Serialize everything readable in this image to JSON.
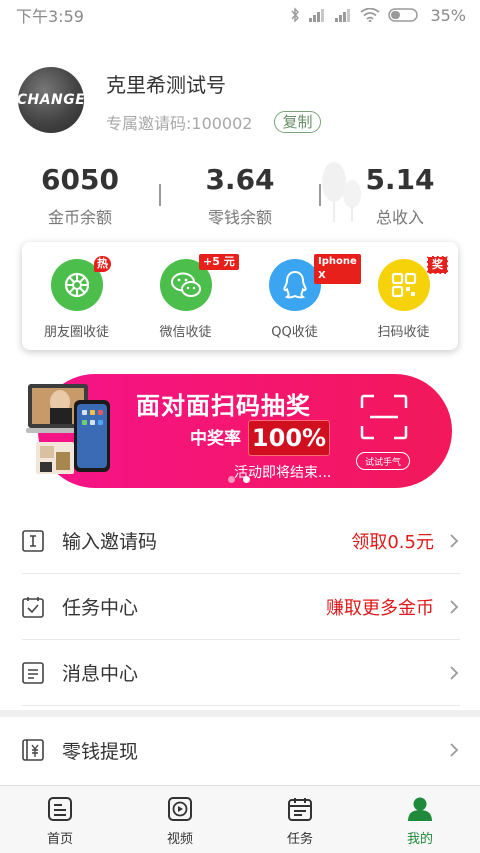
{
  "status_bar": {
    "time": "下午3:59",
    "battery": "35%"
  },
  "profile": {
    "avatar_text": "CHANGE",
    "name": "克里希测试号",
    "invite_code": "专属邀请码:100002",
    "copy_label": "复制"
  },
  "stats": [
    {
      "value": "6050",
      "label": "金币余额"
    },
    {
      "value": "3.64",
      "label": "零钱余额"
    },
    {
      "value": "5.14",
      "label": "总收入"
    }
  ],
  "share": {
    "items": [
      {
        "label": "朋友圈收徒",
        "badge": "热",
        "icon": "moments-icon",
        "color": "#4cbe4c"
      },
      {
        "label": "微信收徒",
        "badge": "+5 元",
        "icon": "wechat-icon",
        "color": "#4cbe4c"
      },
      {
        "label": "QQ收徒",
        "badge": "Iphone X",
        "icon": "qq-icon",
        "color": "#3ba5f2"
      },
      {
        "label": "扫码收徒",
        "badge": "奖",
        "icon": "qrcode-icon",
        "color": "#f5d20a"
      }
    ]
  },
  "banner": {
    "title": "面对面扫码抽奖",
    "rate_label": "中奖率",
    "rate_value": "100%",
    "ending_text": "活动即将结束...",
    "try_label": "试试手气",
    "accent": "#f5138a"
  },
  "list": [
    {
      "label": "输入邀请码",
      "right": "领取0.5元",
      "icon": "invite-code-icon"
    },
    {
      "label": "任务中心",
      "right": "赚取更多金币",
      "icon": "task-center-icon"
    },
    {
      "label": "消息中心",
      "right": "",
      "icon": "message-icon"
    },
    {
      "label": "零钱提现",
      "right": "",
      "icon": "withdraw-icon"
    }
  ],
  "tabbar": {
    "tabs": [
      {
        "label": "首页",
        "icon": "home-icon"
      },
      {
        "label": "视频",
        "icon": "video-icon"
      },
      {
        "label": "任务",
        "icon": "task-icon"
      },
      {
        "label": "我的",
        "icon": "profile-icon",
        "active": true
      }
    ],
    "active_color": "#1f8a3a"
  }
}
